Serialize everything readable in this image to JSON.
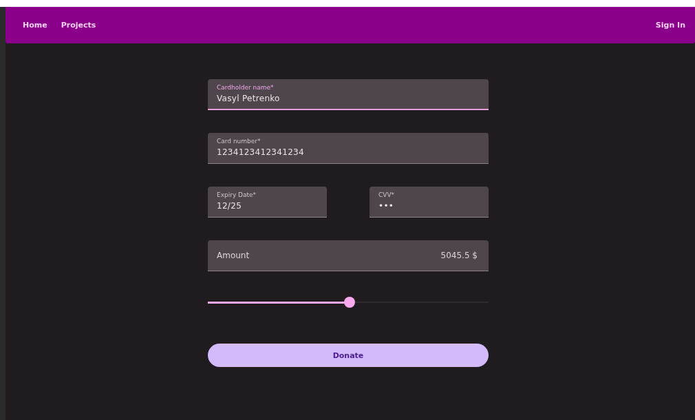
{
  "nav": {
    "links": [
      {
        "label": "Home"
      },
      {
        "label": "Projects"
      }
    ],
    "sign_in": "Sign In"
  },
  "form": {
    "rows": [
      {
        "fields": [
          {
            "kind": "floating",
            "label": "Cardholder name*",
            "value": "Vasyl Petrenko",
            "focused": true
          }
        ]
      },
      {
        "fields": [
          {
            "kind": "floating",
            "label": "Card number*",
            "value": "1234123412341234",
            "focused": false
          }
        ]
      },
      {
        "fields": [
          {
            "kind": "floating",
            "label": "Expiry Date*",
            "value": "12/25",
            "focused": false
          },
          {
            "kind": "floating",
            "label": "CVV*",
            "value": "•••",
            "focused": false
          }
        ]
      },
      {
        "fields": [
          {
            "kind": "inline",
            "label": "Amount",
            "value": "5045.5 $",
            "focused": false
          }
        ]
      }
    ],
    "slider": {
      "level": 0.505
    },
    "button": "Donate"
  }
}
